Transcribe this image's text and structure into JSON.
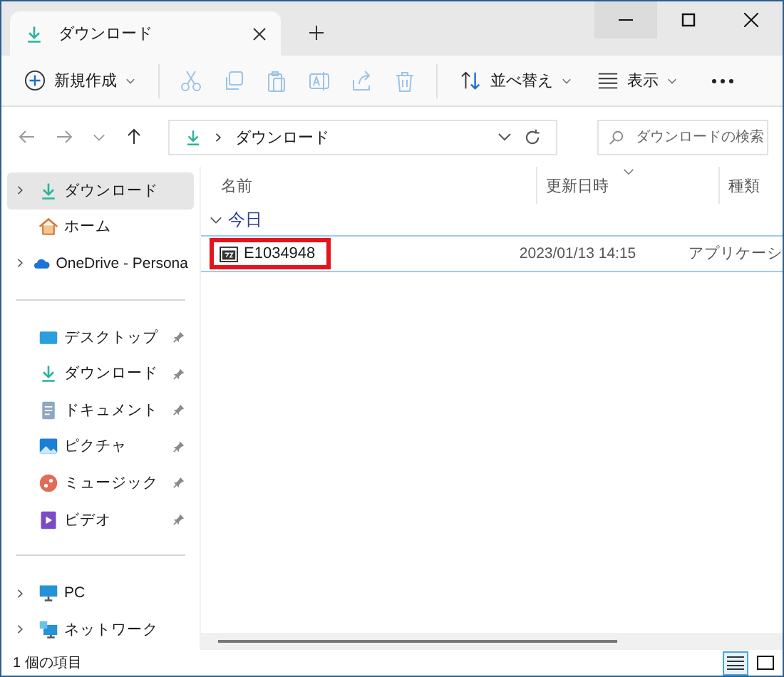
{
  "window": {
    "tab_title": "ダウンロード"
  },
  "toolbar": {
    "new_label": "新規作成",
    "actions": [
      {
        "kind": "cut",
        "disabled": true
      },
      {
        "kind": "copy",
        "disabled": true
      },
      {
        "kind": "paste",
        "disabled": true
      },
      {
        "kind": "rename",
        "disabled": true
      },
      {
        "kind": "share",
        "disabled": true
      },
      {
        "kind": "delete",
        "disabled": true
      }
    ],
    "sort_label": "並べ替え",
    "view_label": "表示"
  },
  "address": {
    "path": "ダウンロード",
    "search_placeholder": "ダウンロードの検索"
  },
  "sidebar": {
    "sections": [
      [
        {
          "label": "ダウンロード",
          "kind": "download",
          "expandable": true,
          "pinned": false,
          "selected": true
        },
        {
          "label": "ホーム",
          "kind": "home",
          "expandable": false,
          "pinned": false,
          "selected": false
        },
        {
          "label": "OneDrive - Persona",
          "kind": "cloud",
          "expandable": true,
          "pinned": false,
          "selected": false
        }
      ],
      [
        {
          "label": "デスクトップ",
          "kind": "desktop",
          "expandable": false,
          "pinned": true,
          "selected": false
        },
        {
          "label": "ダウンロード",
          "kind": "download",
          "expandable": false,
          "pinned": true,
          "selected": false
        },
        {
          "label": "ドキュメント",
          "kind": "document",
          "expandable": false,
          "pinned": true,
          "selected": false
        },
        {
          "label": "ピクチャ",
          "kind": "picture",
          "expandable": false,
          "pinned": true,
          "selected": false
        },
        {
          "label": "ミュージック",
          "kind": "music",
          "expandable": false,
          "pinned": true,
          "selected": false
        },
        {
          "label": "ビデオ",
          "kind": "video",
          "expandable": false,
          "pinned": true,
          "selected": false
        }
      ],
      [
        {
          "label": "PC",
          "kind": "pc",
          "expandable": true,
          "pinned": false,
          "selected": false
        },
        {
          "label": "ネットワーク",
          "kind": "network",
          "expandable": true,
          "pinned": false,
          "selected": false
        }
      ]
    ]
  },
  "table": {
    "columns": [
      {
        "label": "名前",
        "sorted": false
      },
      {
        "label": "更新日時",
        "sorted": true
      },
      {
        "label": "種類",
        "sorted": false
      }
    ],
    "groups": [
      {
        "label": "今日",
        "expanded": true,
        "rows": [
          {
            "name": "E1034948",
            "modified": "2023/01/13 14:15",
            "type": "アプリケーシ",
            "selected": true,
            "highlighted": true
          }
        ]
      }
    ]
  },
  "status_bar": {
    "text": "1 個の項目",
    "views": [
      {
        "kind": "details",
        "selected": true
      },
      {
        "kind": "tiles",
        "selected": false
      }
    ]
  }
}
